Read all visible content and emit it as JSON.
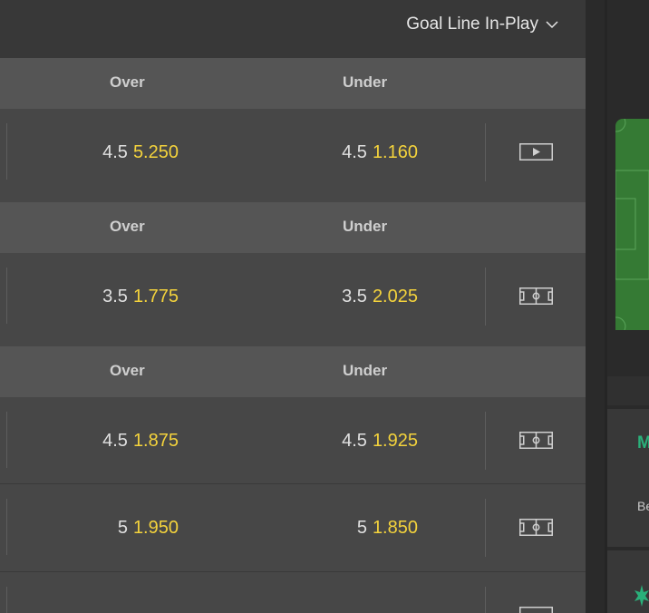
{
  "market": {
    "selected": "Goal Line In-Play"
  },
  "header_labels": {
    "over": "Over",
    "under": "Under"
  },
  "sections": [
    {
      "header": true,
      "rows": [
        {
          "over_line": "4.5",
          "over_price": "5.250",
          "under_line": "4.5",
          "under_price": "1.160",
          "icon": "play-video-icon"
        }
      ]
    },
    {
      "header": true,
      "rows": [
        {
          "over_line": "3.5",
          "over_price": "1.775",
          "under_line": "3.5",
          "under_price": "2.025",
          "icon": "pitch-icon"
        }
      ]
    },
    {
      "header": true,
      "rows": [
        {
          "over_line": "4.5",
          "over_price": "1.875",
          "under_line": "4.5",
          "under_price": "1.925",
          "icon": "pitch-icon"
        },
        {
          "over_line": "5",
          "over_price": "1.950",
          "under_line": "5",
          "under_price": "1.850",
          "icon": "pitch-icon"
        }
      ]
    }
  ],
  "sidebar": {
    "card_title": "M",
    "card_text": "Be"
  },
  "colors": {
    "price": "#f4d33c",
    "accent_green": "#2ab07a",
    "pitch_green": "#357a34"
  }
}
